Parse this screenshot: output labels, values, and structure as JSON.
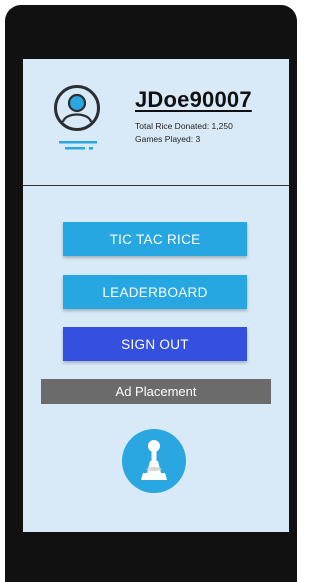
{
  "profile": {
    "username": "JDoe90007",
    "total_rice_donated": "Total Rice Donated: 1,250",
    "games_played": "Games Played: 3"
  },
  "menu": {
    "tic_tac_rice_label": "TIC TAC RICE",
    "leaderboard_label": "LEADERBOARD",
    "sign_out_label": "SIGN OUT"
  },
  "ad": {
    "label": "Ad Placement"
  },
  "icons": {
    "avatar": "user-avatar-icon",
    "game_piece": "pawn-icon"
  },
  "colors": {
    "screen_background": "#d8eaf8",
    "primary_button": "#27a7e2",
    "sign_out_button": "#3550de",
    "ad_background": "#6b6b6b",
    "phone_frame": "#111111"
  }
}
